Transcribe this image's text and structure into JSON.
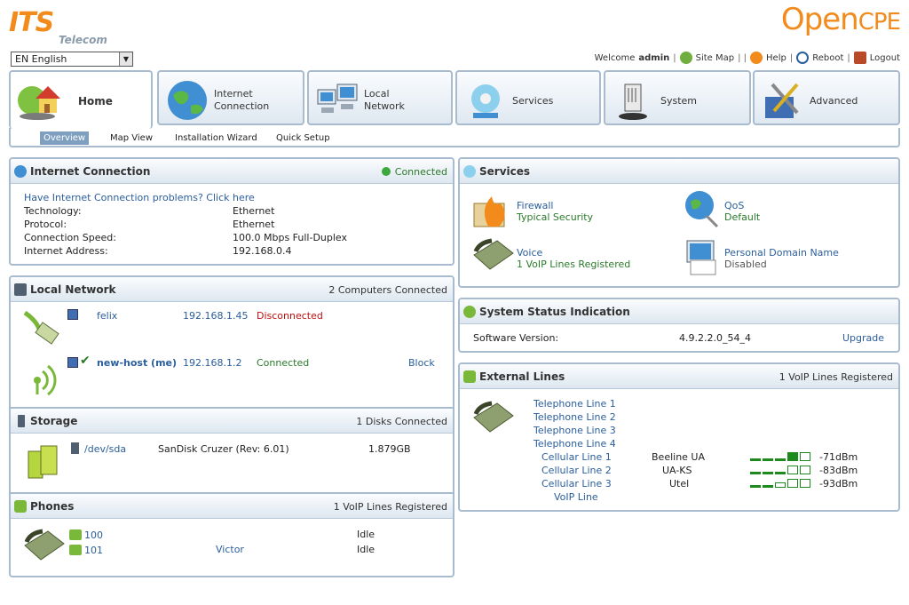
{
  "logo": {
    "its": "ITS",
    "telecom": "Telecom",
    "open": "Open",
    "cpe": "CPE"
  },
  "language": {
    "selected": "EN English"
  },
  "toplinks": {
    "welcome": "Welcome",
    "user": "admin",
    "sitemap": "Site Map",
    "help": "Help",
    "reboot": "Reboot",
    "logout": "Logout"
  },
  "tabs": [
    {
      "label": "Home",
      "icon": "house-icon"
    },
    {
      "label": "Internet Connection",
      "line1": "Internet",
      "line2": "Connection",
      "icon": "globe-icon"
    },
    {
      "label": "Local Network",
      "line1": "Local",
      "line2": "Network",
      "icon": "computers-icon"
    },
    {
      "label": "Services",
      "icon": "services-icon"
    },
    {
      "label": "System",
      "icon": "router-icon"
    },
    {
      "label": "Advanced",
      "icon": "tools-icon"
    }
  ],
  "subtabs": [
    {
      "label": "Overview"
    },
    {
      "label": "Map View"
    },
    {
      "label": "Installation Wizard"
    },
    {
      "label": "Quick Setup"
    }
  ],
  "internet": {
    "title": "Internet Connection",
    "status": "Connected",
    "problem_link": "Have Internet Connection problems? Click here",
    "rows": [
      {
        "k": "Technology:",
        "v": "Ethernet"
      },
      {
        "k": "Protocol:",
        "v": "Ethernet"
      },
      {
        "k": "Connection Speed:",
        "v": "100.0 Mbps Full-Duplex"
      },
      {
        "k": "Internet Address:",
        "v": "192.168.0.4"
      }
    ]
  },
  "local": {
    "title": "Local Network",
    "count": "2 Computers Connected",
    "hosts": [
      {
        "name": "felix",
        "ip": "192.168.1.45",
        "status": "Disconnected",
        "action": ""
      },
      {
        "name": "new-host (me)",
        "ip": "192.168.1.2",
        "status": "Connected",
        "action": "Block"
      }
    ]
  },
  "storage": {
    "title": "Storage",
    "count": "1 Disks Connected",
    "device": "/dev/sda",
    "model": "SanDisk Cruzer (Rev: 6.01)",
    "size": "1.879GB"
  },
  "phones": {
    "title": "Phones",
    "count": "1 VoIP Lines Registered",
    "lines": [
      {
        "num": "100",
        "name": "",
        "state": "Idle"
      },
      {
        "num": "101",
        "name": "Victor",
        "state": "Idle"
      }
    ]
  },
  "services": {
    "title": "Services",
    "items": [
      {
        "name": "Firewall",
        "sub": "Typical Security"
      },
      {
        "name": "QoS",
        "sub": "Default"
      },
      {
        "name": "Voice",
        "sub": "1 VoIP Lines Registered"
      },
      {
        "name": "Personal Domain Name",
        "sub": "Disabled"
      }
    ]
  },
  "sysstatus": {
    "title": "System Status Indication",
    "label": "Software Version:",
    "version": "4.9.2.2.0_54_4",
    "action": "Upgrade"
  },
  "external": {
    "title": "External Lines",
    "count": "1 VoIP Lines Registered",
    "telephone": [
      "Telephone Line 1",
      "Telephone Line 2",
      "Telephone Line 3",
      "Telephone Line 4"
    ],
    "cellular": [
      {
        "name": "Cellular Line 1",
        "operator": "Beeline UA",
        "signal": "-71dBm",
        "level": 4
      },
      {
        "name": "Cellular Line 2",
        "operator": "UA-KS",
        "signal": "-83dBm",
        "level": 3
      },
      {
        "name": "Cellular Line 3",
        "operator": "Utel",
        "signal": "-93dBm",
        "level": 2
      }
    ],
    "voip": "VoIP Line"
  },
  "colors": {
    "accent": "#f28a1c",
    "border": "#a9bccf",
    "link": "#2a5e9c",
    "ok": "#2a7a2a",
    "bad": "#c01010"
  }
}
